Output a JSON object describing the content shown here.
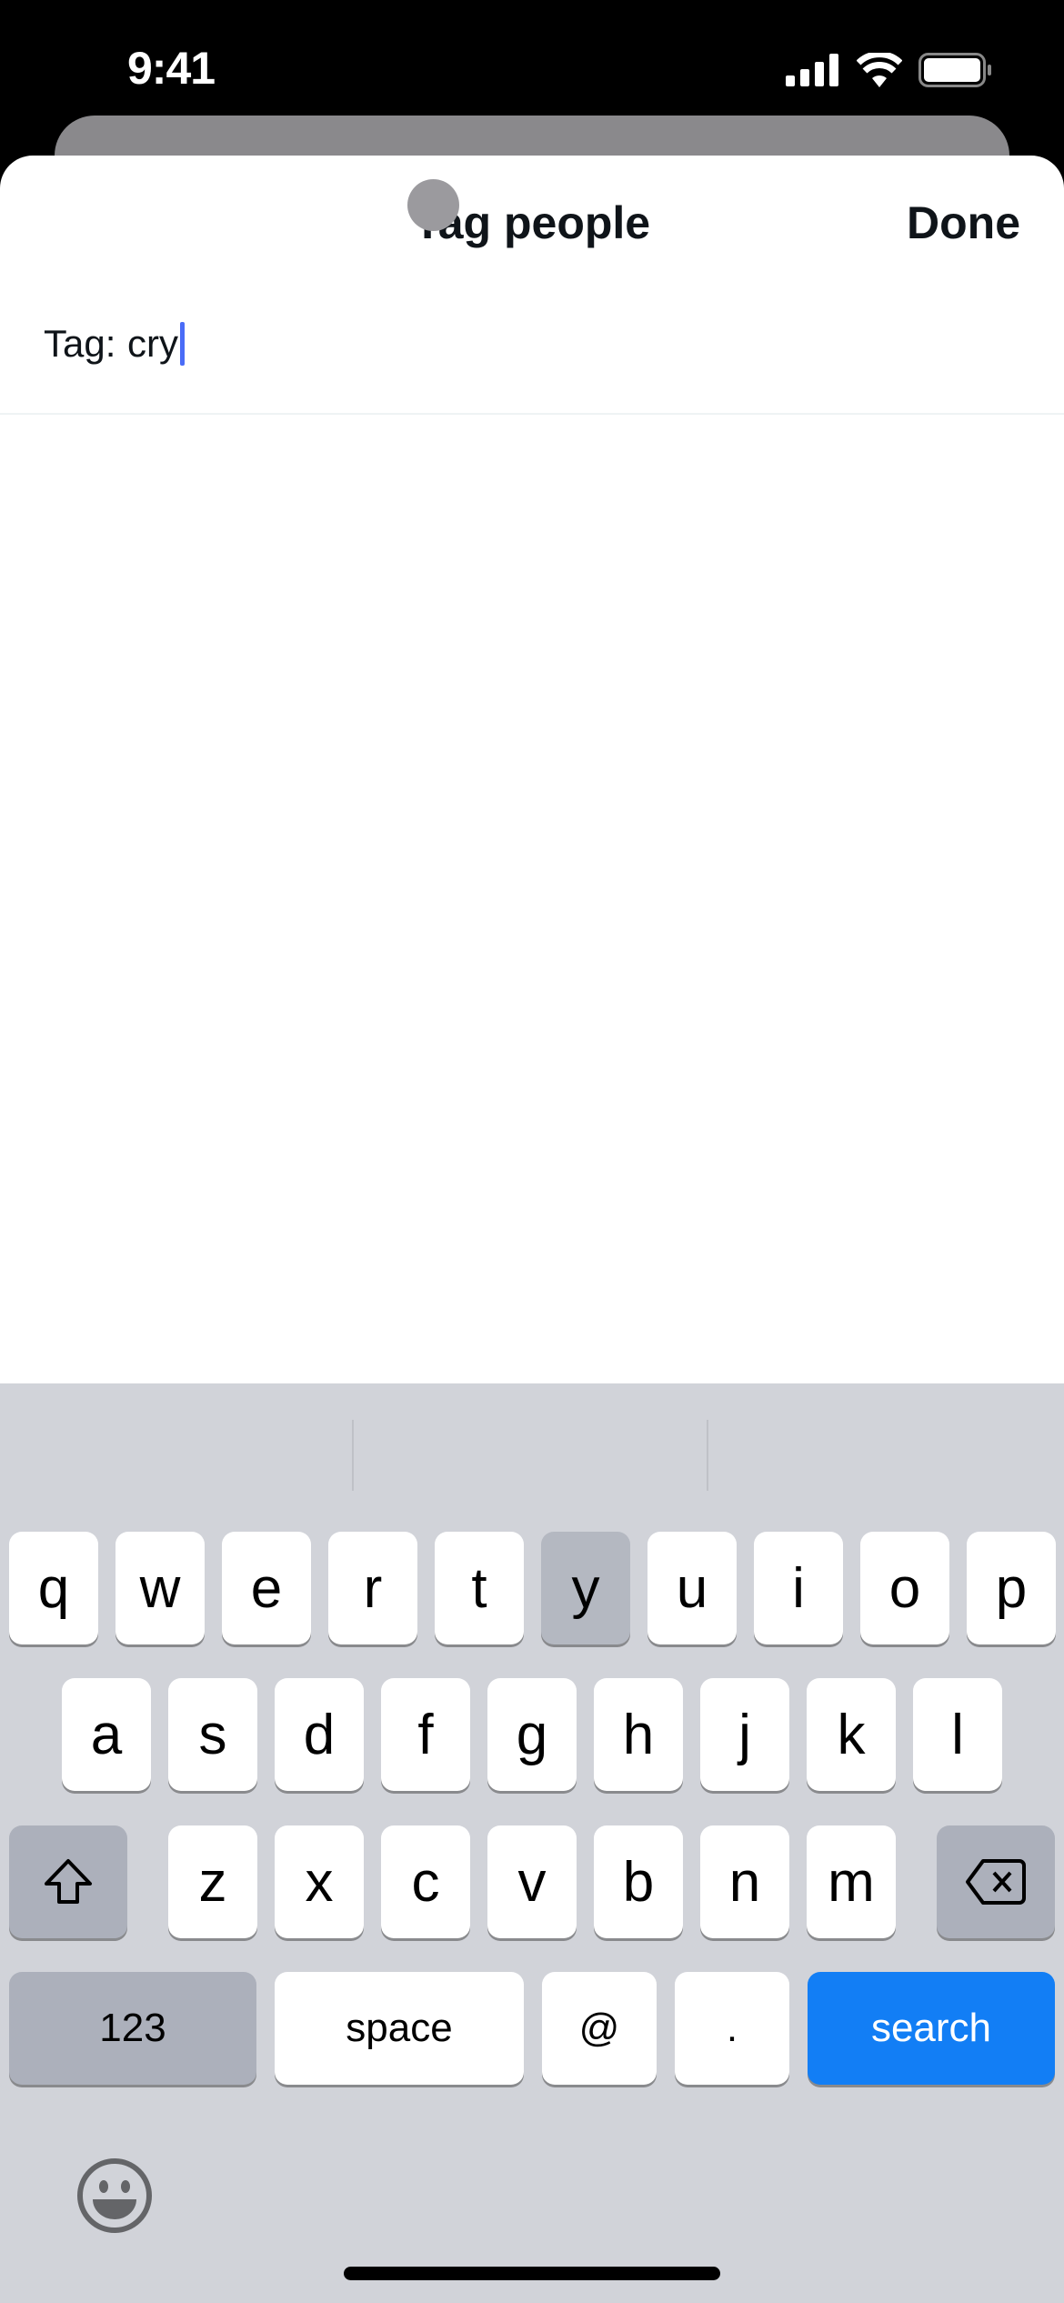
{
  "status_bar": {
    "time": "9:41"
  },
  "header": {
    "title": "Tag people",
    "done_label": "Done"
  },
  "tag_field": {
    "label": "Tag:",
    "value": "cry"
  },
  "keyboard": {
    "row1": [
      "q",
      "w",
      "e",
      "r",
      "t",
      "y",
      "u",
      "i",
      "o",
      "p"
    ],
    "row2": [
      "a",
      "s",
      "d",
      "f",
      "g",
      "h",
      "j",
      "k",
      "l"
    ],
    "row3": [
      "z",
      "x",
      "c",
      "v",
      "b",
      "n",
      "m"
    ],
    "numbers_label": "123",
    "space_label": "space",
    "at_label": "@",
    "dot_label": ".",
    "search_label": "search",
    "pressed_key": "y",
    "accent_color": "#127ef5"
  }
}
